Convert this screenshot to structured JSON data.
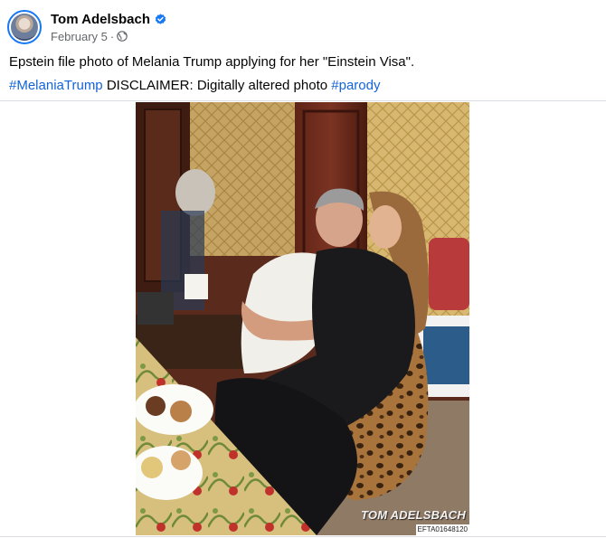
{
  "author": {
    "name": "Tom Adelsbach",
    "verified": true,
    "avatar_icon": "profile-photo"
  },
  "post_meta": {
    "date": "February 5",
    "separator": "·",
    "audience_icon": "globe-icon"
  },
  "post": {
    "line1": "Epstein file photo of Melania Trump applying for her \"Einstein Visa\".",
    "hashtag1": "#MelaniaTrump",
    "disclaimer": " DISCLAIMER: Digitally altered photo ",
    "hashtag2": "#parody"
  },
  "photo": {
    "watermark": "TOM ADELSBACH",
    "file_id": "EFTA01648120"
  },
  "colors": {
    "link": "#1264d8",
    "verified": "#1877f2",
    "secondary_text": "#65676b"
  }
}
